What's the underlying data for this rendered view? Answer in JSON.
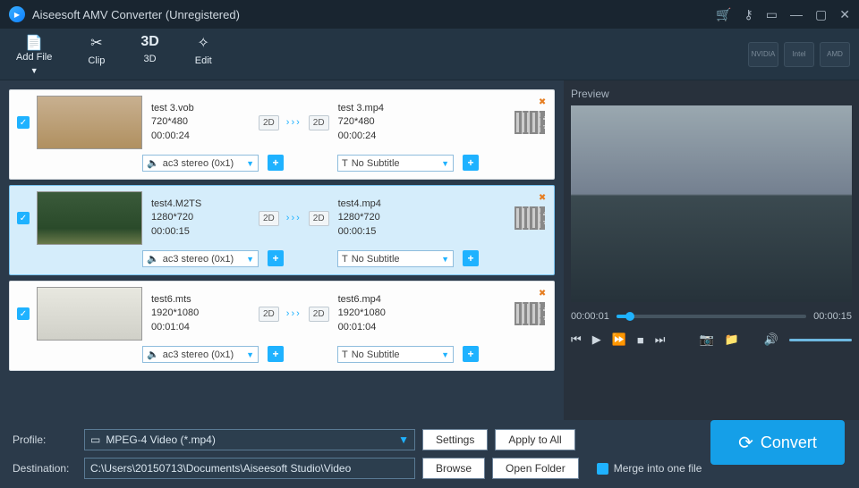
{
  "titlebar": {
    "title": "Aiseesoft AMV Converter (Unregistered)"
  },
  "toolbar": {
    "add_file": "Add File",
    "clip": "Clip",
    "threeD": "3D",
    "edit": "Edit",
    "gpu": [
      "NVIDIA",
      "Intel",
      "AMD"
    ]
  },
  "items": [
    {
      "checked": true,
      "selected": false,
      "thumb": "shop",
      "src_name": "test 3.vob",
      "src_res": "720*480",
      "src_dur": "00:00:24",
      "dst_name": "test 3.mp4",
      "dst_res": "720*480",
      "dst_dur": "00:00:24",
      "audio": "ac3 stereo (0x1)",
      "subtitle": "No Subtitle"
    },
    {
      "checked": true,
      "selected": true,
      "thumb": "forest",
      "src_name": "test4.M2TS",
      "src_res": "1280*720",
      "src_dur": "00:00:15",
      "dst_name": "test4.mp4",
      "dst_res": "1280*720",
      "dst_dur": "00:00:15",
      "audio": "ac3 stereo (0x1)",
      "subtitle": "No Subtitle"
    },
    {
      "checked": true,
      "selected": false,
      "thumb": "studio",
      "src_name": "test6.mts",
      "src_res": "1920*1080",
      "src_dur": "00:01:04",
      "dst_name": "test6.mp4",
      "dst_res": "1920*1080",
      "dst_dur": "00:01:04",
      "audio": "ac3 stereo (0x1)",
      "subtitle": "No Subtitle"
    }
  ],
  "preview": {
    "title": "Preview",
    "elapsed": "00:00:01",
    "total": "00:00:15",
    "progress_pct": 7
  },
  "bottom": {
    "profile_label": "Profile:",
    "profile_value": "MPEG-4 Video (*.mp4)",
    "settings": "Settings",
    "apply_all": "Apply to All",
    "destination_label": "Destination:",
    "destination_value": "C:\\Users\\20150713\\Documents\\Aiseesoft Studio\\Video",
    "browse": "Browse",
    "open_folder": "Open Folder",
    "merge": "Merge into one file",
    "convert": "Convert"
  },
  "badges": {
    "twoD": "2D"
  }
}
